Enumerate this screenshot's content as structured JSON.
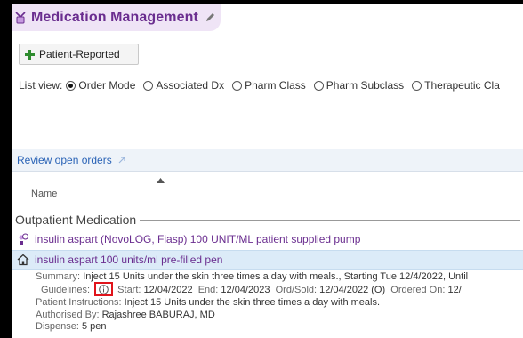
{
  "header": {
    "title": "Medication Management"
  },
  "toolbar": {
    "patient_reported_label": "Patient-Reported"
  },
  "listview": {
    "label": "List view:",
    "options": [
      {
        "label": "Order Mode",
        "selected": true
      },
      {
        "label": "Associated Dx",
        "selected": false
      },
      {
        "label": "Pharm Class",
        "selected": false
      },
      {
        "label": "Pharm Subclass",
        "selected": false
      },
      {
        "label": "Therapeutic Cla",
        "selected": false
      }
    ]
  },
  "review": {
    "label": "Review open orders"
  },
  "table": {
    "col_name": "Name"
  },
  "section": {
    "title": "Outpatient Medication"
  },
  "medications": [
    {
      "name": "insulin aspart (NovoLOG, Fiasp) 100 UNIT/ML patient supplied pump"
    },
    {
      "name": "insulin aspart 100 units/ml pre-filled pen"
    }
  ],
  "details": {
    "summary_label": "Summary:",
    "summary_value": "Inject 15 Units under the skin three times a day with meals., Starting Tue 12/4/2022, Until",
    "guidelines_label": "Guidelines:",
    "start_label": "Start:",
    "start_value": "12/04/2022",
    "end_label": "End:",
    "end_value": "12/04/2023",
    "ordsold_label": "Ord/Sold:",
    "ordsold_value": "12/04/2022 (O)",
    "ordered_label": "Ordered On:",
    "ordered_value": "12/",
    "instructions_label": "Patient Instructions:",
    "instructions_value": "Inject 15 Units under the skin three times a day with meals.",
    "authorised_label": "Authorised By:",
    "authorised_value": "Rajashree BABURAJ, MD",
    "dispense_label": "Dispense:",
    "dispense_value": "5 pen"
  },
  "colors": {
    "accent_purple": "#6a2d8f",
    "header_bg": "#efe4f6",
    "link_blue": "#2a63b6",
    "selected_row": "#dcebf8",
    "highlight_red": "#e0141b",
    "plus_green": "#2e8b2e"
  }
}
